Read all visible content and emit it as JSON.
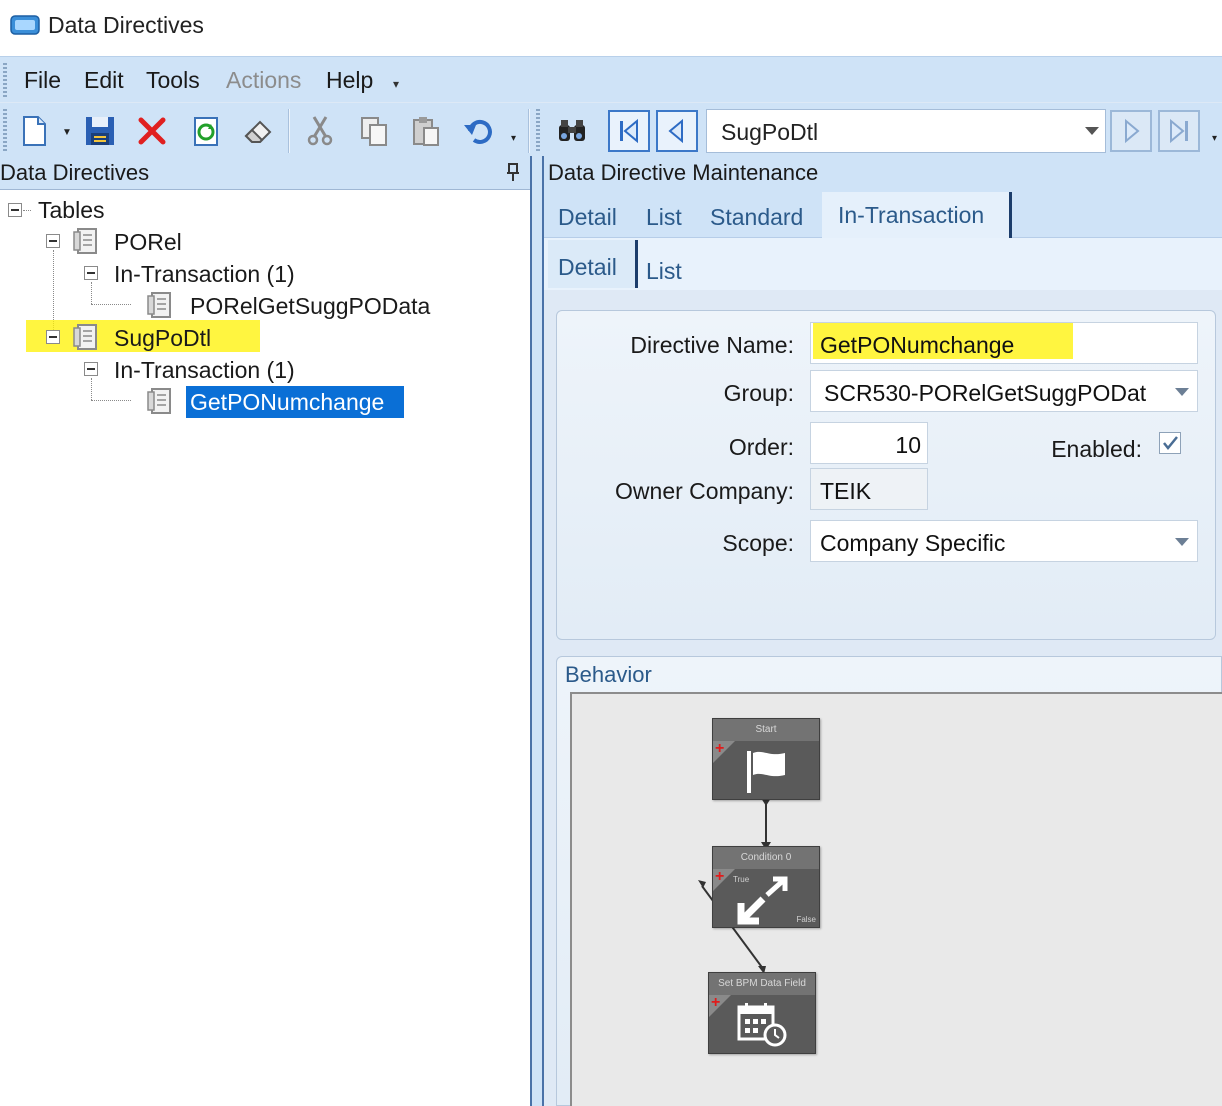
{
  "window": {
    "title": "Data Directives"
  },
  "menu": {
    "items": [
      {
        "label": "File",
        "enabled": true
      },
      {
        "label": "Edit",
        "enabled": true
      },
      {
        "label": "Tools",
        "enabled": true
      },
      {
        "label": "Actions",
        "enabled": false
      },
      {
        "label": "Help",
        "enabled": true
      }
    ]
  },
  "toolbar": {
    "buttons": [
      "new-icon",
      "save-icon",
      "delete-icon",
      "refresh-icon",
      "clear-icon",
      "cut-icon",
      "copy-icon",
      "paste-icon",
      "undo-icon",
      "search-icon",
      "first-record-icon",
      "previous-record-icon",
      "next-record-icon",
      "last-record-icon"
    ],
    "record_combo_value": "SugPoDtl"
  },
  "left_panel": {
    "title": "Data Directives",
    "tree": {
      "root": "Tables",
      "porel": "PORel",
      "porel_in_transaction": "In-Transaction (1)",
      "porel_directive": "PORelGetSuggPOData",
      "sugpodtl": "SugPoDtl",
      "sugpodtl_in_transaction": "In-Transaction (1)",
      "sugpodtl_directive": "GetPONumchange"
    }
  },
  "right_panel": {
    "title": "Data Directive Maintenance",
    "tabs": [
      "Detail",
      "List",
      "Standard",
      "In-Transaction"
    ],
    "active_tab": "In-Transaction",
    "subtabs": [
      "Detail",
      "List"
    ],
    "active_subtab": "Detail",
    "form": {
      "directive_name_label": "Directive Name:",
      "directive_name_value": "GetPONumchange",
      "group_label": "Group:",
      "group_value": "SCR530-PORelGetSuggPODat",
      "order_label": "Order:",
      "order_value": "10",
      "enabled_label": "Enabled:",
      "enabled_checked": true,
      "owner_company_label": "Owner Company:",
      "owner_company_value": "TEIK",
      "scope_label": "Scope:",
      "scope_value": "Company Specific"
    },
    "behavior": {
      "title": "Behavior",
      "nodes": [
        {
          "title": "Start",
          "icon": "flag-icon"
        },
        {
          "title": "Condition 0",
          "icon": "condition-arrows-icon",
          "true_label": "True",
          "false_label": "False"
        },
        {
          "title": "Set BPM Data Field",
          "icon": "calendar-clock-icon"
        }
      ]
    }
  },
  "colors": {
    "chrome": "#cfe3f7",
    "selection": "#0a6fd6",
    "highlight": "#fff200",
    "node": "#5a5a5a"
  }
}
